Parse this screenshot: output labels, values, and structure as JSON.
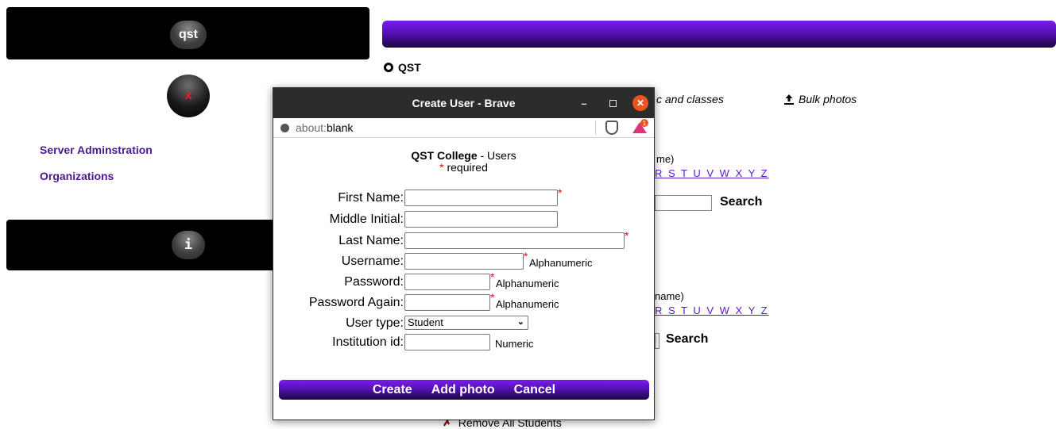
{
  "left": {
    "top_orb_label": "qst",
    "close_orb_label": "x",
    "links": [
      "Server Adminstration",
      "Organizations"
    ],
    "info_orb_label": "i"
  },
  "main": {
    "radio_label": "QST",
    "topics_link_partial": "c and classes",
    "bulk_photos_label": "Bulk photos",
    "section1": {
      "hint_partial": "me)",
      "letters_partial": "R S T U V W X Y Z",
      "search_label": "Search"
    },
    "section2": {
      "hint_partial": "name)",
      "letters_partial": "R S T U V W X Y Z",
      "search_label": "Search"
    },
    "remove_all_label": "Remove All Students"
  },
  "popup": {
    "window_title": "Create User - Brave",
    "url_scheme": "about:",
    "url_path": "blank",
    "brave_badge_count": "1",
    "org_name": "QST College",
    "org_suffix": " - Users",
    "required_star": "*",
    "required_note": " required",
    "fields": {
      "first_name": {
        "label": "First Name:",
        "value": "",
        "star": "*"
      },
      "middle_initial": {
        "label": "Middle Initial:",
        "value": ""
      },
      "last_name": {
        "label": "Last Name:",
        "value": "",
        "star": "*"
      },
      "username": {
        "label": "Username:",
        "value": "",
        "star": "*",
        "hint": "Alphanumeric"
      },
      "password": {
        "label": "Password:",
        "value": "",
        "star": "*",
        "hint": "Alphanumeric"
      },
      "password_again": {
        "label": "Password Again:",
        "value": "",
        "star": "*",
        "hint": "Alphanumeric"
      },
      "user_type": {
        "label": "User type:",
        "selected": "Student"
      },
      "institution_id": {
        "label": "Institution id:",
        "value": "",
        "hint": "Numeric"
      }
    },
    "actions": {
      "create": "Create",
      "add_photo": "Add photo",
      "cancel": "Cancel"
    }
  },
  "colors": {
    "accent_purple": "#5511b5",
    "link_purple": "#4b1a8c",
    "required_red": "#d01010",
    "close_orange": "#e95420"
  }
}
